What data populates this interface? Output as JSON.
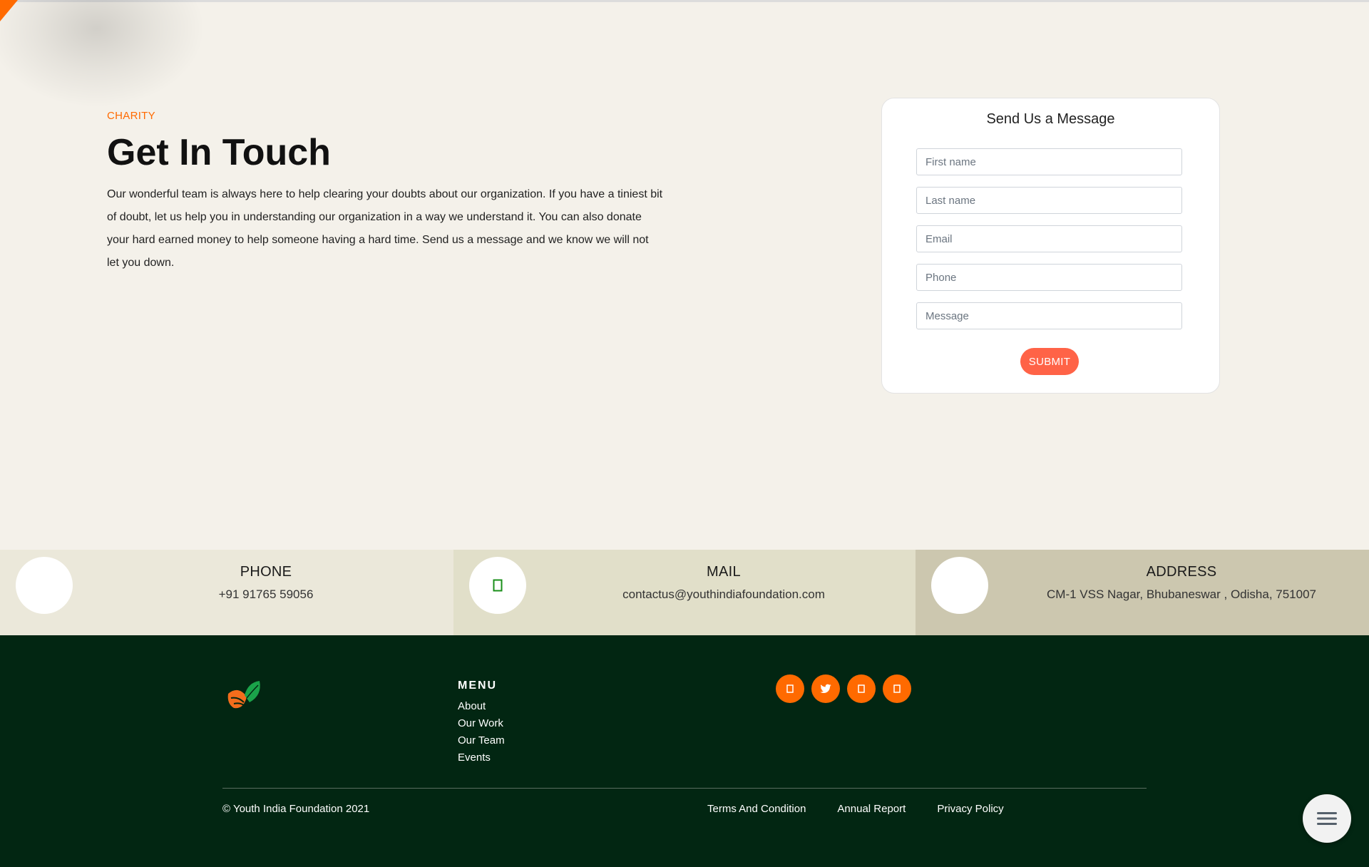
{
  "hero": {
    "eyebrow": "CHARITY",
    "title": "Get In Touch",
    "description": "Our wonderful team is always here to help clearing your doubts about our organization. If you have a tiniest bit of doubt, let us help you in understanding our organization in a way we understand it. You can also donate your hard earned money to help someone having a hard time. Send us a message and we know we will not let you down."
  },
  "form": {
    "title": "Send Us a Message",
    "first_name": {
      "placeholder": "First name",
      "value": ""
    },
    "last_name": {
      "placeholder": "Last name",
      "value": ""
    },
    "email": {
      "placeholder": "Email",
      "value": ""
    },
    "phone": {
      "placeholder": "Phone",
      "value": ""
    },
    "message": {
      "placeholder": "Message",
      "value": ""
    },
    "submit_label": "SUBMIT"
  },
  "contact": [
    {
      "label": "PHONE",
      "value": "+91 91765 59056",
      "icon": "phone-icon",
      "bg": "#ebe8da"
    },
    {
      "label": "MAIL",
      "value": "contactus@youthindiafoundation.com",
      "icon": "mail-icon",
      "bg": "#e1dfc9"
    },
    {
      "label": "ADDRESS",
      "value": "CM-1 VSS Nagar, Bhubaneswar , Odisha, 751007",
      "icon": "location-icon",
      "bg": "#ccc7af"
    }
  ],
  "footer": {
    "menu_heading": "MENU",
    "menu_items": [
      "About",
      "Our Work",
      "Our Team",
      "Events"
    ],
    "socials": [
      "facebook-icon",
      "twitter-icon",
      "instagram-icon",
      "youtube-icon"
    ],
    "copyright": "© Youth India Foundation 2021",
    "legal_links": [
      "Terms And Condition",
      "Annual Report",
      "Privacy Policy"
    ]
  },
  "colors": {
    "accent": "#ff6a00",
    "submit": "#ff6347",
    "footer_bg": "#022612",
    "page_bg": "#f4f1ea"
  }
}
